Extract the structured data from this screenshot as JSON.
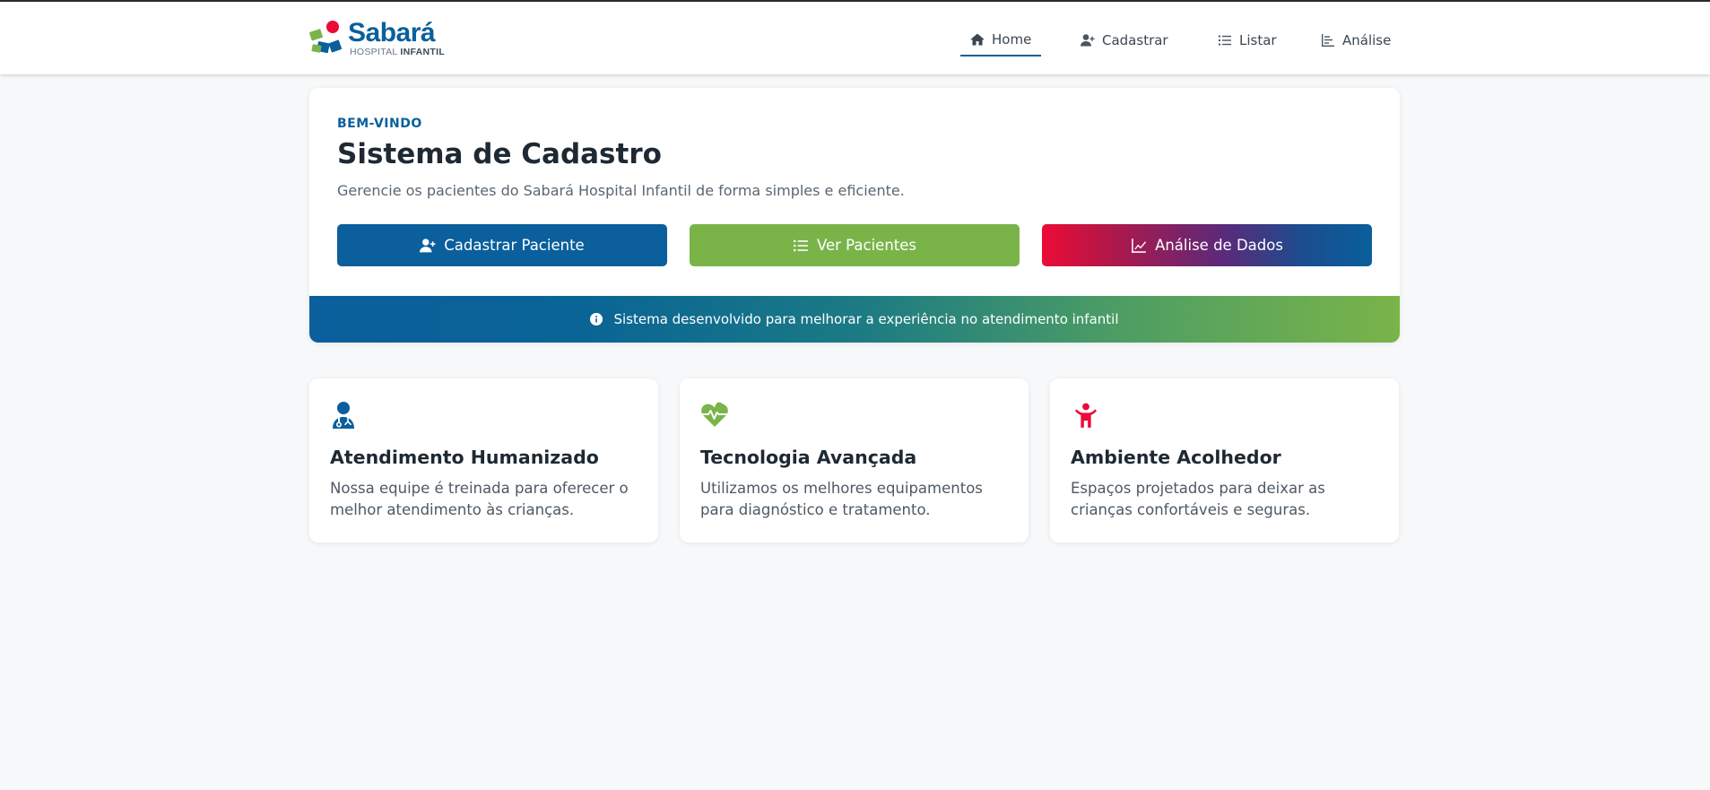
{
  "brand": {
    "name": "Sabará",
    "sub_prefix": "HOSPITAL",
    "sub_bold": "INFANTIL",
    "colors": {
      "blue": "#0a5f9c",
      "green": "#7ab449",
      "red": "#ec0b36"
    }
  },
  "nav": {
    "items": [
      {
        "label": "Home",
        "icon": "home-icon",
        "active": true
      },
      {
        "label": "Cadastrar",
        "icon": "user-plus-icon",
        "active": false
      },
      {
        "label": "Listar",
        "icon": "list-icon",
        "active": false
      },
      {
        "label": "Análise",
        "icon": "chart-icon",
        "active": false
      }
    ]
  },
  "hero": {
    "eyebrow": "BEM-VINDO",
    "title": "Sistema de Cadastro",
    "subtitle": "Gerencie os pacientes do Sabará Hospital Infantil de forma simples e eficiente.",
    "buttons": [
      {
        "label": "Cadastrar Paciente",
        "icon": "user-plus-icon"
      },
      {
        "label": "Ver Pacientes",
        "icon": "list-icon"
      },
      {
        "label": "Análise de Dados",
        "icon": "line-chart-icon"
      }
    ],
    "banner": {
      "text": "Sistema desenvolvido para melhorar a experiência no atendimento infantil",
      "icon": "info-icon"
    }
  },
  "features": [
    {
      "title": "Atendimento Humanizado",
      "text": "Nossa equipe é treinada para oferecer o melhor atendimento às crianças.",
      "icon": "doctor-icon",
      "color": "#0a5f9c"
    },
    {
      "title": "Tecnologia Avançada",
      "text": "Utilizamos os melhores equipamentos para diagnóstico e tratamento.",
      "icon": "heartbeat-icon",
      "color": "#7ab449"
    },
    {
      "title": "Ambiente Acolhedor",
      "text": "Espaços projetados para deixar as crianças confortáveis e seguras.",
      "icon": "child-icon",
      "color": "#ec0b36"
    }
  ]
}
